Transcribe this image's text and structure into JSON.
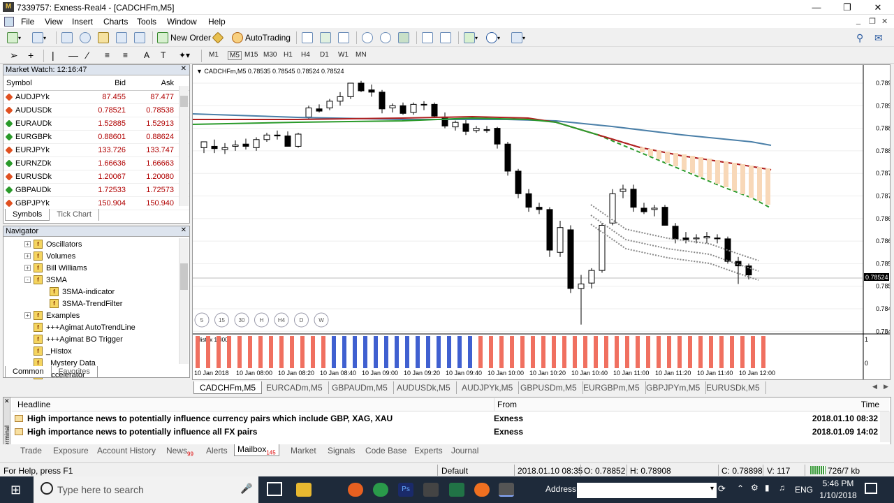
{
  "window": {
    "title": "7339757: Exness-Real4 - [CADCHFm,M5]"
  },
  "menu": [
    "File",
    "View",
    "Insert",
    "Charts",
    "Tools",
    "Window",
    "Help"
  ],
  "toolbar": {
    "new_order": "New Order",
    "auto_trading": "AutoTrading"
  },
  "timeframes": [
    "M1",
    "M5",
    "M15",
    "M30",
    "H1",
    "H4",
    "D1",
    "W1",
    "MN"
  ],
  "market_watch": {
    "title": "Market Watch: 12:16:47",
    "cols": [
      "Symbol",
      "Bid",
      "Ask"
    ],
    "rows": [
      {
        "symbol": "AUDJPYk",
        "bid": "87.455",
        "ask": "87.477",
        "dir": "down"
      },
      {
        "symbol": "AUDUSDk",
        "bid": "0.78521",
        "ask": "0.78538",
        "dir": "down"
      },
      {
        "symbol": "EURAUDk",
        "bid": "1.52885",
        "ask": "1.52913",
        "dir": "up"
      },
      {
        "symbol": "EURGBPk",
        "bid": "0.88601",
        "ask": "0.88624",
        "dir": "up"
      },
      {
        "symbol": "EURJPYk",
        "bid": "133.726",
        "ask": "133.747",
        "dir": "down"
      },
      {
        "symbol": "EURNZDk",
        "bid": "1.66636",
        "ask": "1.66663",
        "dir": "up"
      },
      {
        "symbol": "EURUSDk",
        "bid": "1.20067",
        "ask": "1.20080",
        "dir": "down"
      },
      {
        "symbol": "GBPAUDk",
        "bid": "1.72533",
        "ask": "1.72573",
        "dir": "up"
      },
      {
        "symbol": "GBPJPYk",
        "bid": "150.904",
        "ask": "150.940",
        "dir": "down"
      }
    ],
    "tabs": [
      "Symbols",
      "Tick Chart"
    ]
  },
  "navigator": {
    "title": "Navigator",
    "items": [
      "Oscillators",
      "Volumes",
      "Bill Williams",
      "3SMA",
      "3SMA-indicator",
      "3SMA-TrendFilter",
      "Examples",
      "+++Agimat AutoTrendLine",
      "+++Agimat BO Trigger",
      "_Histox",
      "_Mystery Data",
      "Accelerator"
    ],
    "tabs": [
      "Common",
      "Favorites"
    ]
  },
  "chart": {
    "header": "CADCHFm,M5  0.78535 0.78545 0.78524 0.78524",
    "price_labels": [
      "0.78955",
      "0.78905",
      "0.78855",
      "0.78805",
      "0.78755",
      "0.78705",
      "0.78655",
      "0.78605",
      "0.78555",
      "0.78505",
      "0.78455",
      "0.78405"
    ],
    "current_price": "0.78524",
    "time_labels": [
      "10 Jan 2018",
      "10 Jan 08:00",
      "10 Jan 08:20",
      "10 Jan 08:40",
      "10 Jan 09:00",
      "10 Jan 09:20",
      "10 Jan 09:40",
      "10 Jan 10:00",
      "10 Jan 10:20",
      "10 Jan 10:40",
      "10 Jan 11:00",
      "10 Jan 11:20",
      "10 Jan 11:40",
      "10 Jan 12:00"
    ],
    "tf_buttons": [
      "5",
      "15",
      "30",
      "H",
      "H4",
      "D",
      "W"
    ],
    "sub_label": "Histox 1.0000",
    "sub_scale": [
      "1",
      "0"
    ]
  },
  "chart_tabs": [
    "CADCHFm,M5",
    "EURCADm,M5",
    "GBPAUDm,M5",
    "AUDUSDk,M5",
    "AUDJPYk,M5",
    "GBPUSDm,M5",
    "EURGBPm,M5",
    "GBPJPYm,M5",
    "EURUSDk,M5"
  ],
  "terminal": {
    "cols": [
      "Headline",
      "From",
      "Time"
    ],
    "rows": [
      {
        "headline": "High importance news to potentially influence currency pairs which include GBP, XAG, XAU",
        "from": "Exness",
        "time": "2018.01.10 08:32"
      },
      {
        "headline": "High importance news to potentially influence all FX pairs",
        "from": "Exness",
        "time": "2018.01.09 14:02"
      }
    ],
    "tabs": [
      "Trade",
      "Exposure",
      "Account History",
      "News",
      "Alerts",
      "Mailbox",
      "Market",
      "Signals",
      "Code Base",
      "Experts",
      "Journal"
    ],
    "news_badge": "99",
    "mailbox_badge": "145",
    "side_label": "Terminal"
  },
  "status": {
    "help": "For Help, press F1",
    "profile": "Default",
    "datetime": "2018.01.10 08:35",
    "open": "O: 0.78852",
    "high": "H: 0.78908",
    "close": "C: 0.78898",
    "volume": "V: 117",
    "traffic": "726/7 kb"
  },
  "taskbar": {
    "search_placeholder": "Type here to search",
    "address_label": "Address",
    "lang": "ENG",
    "time": "5:46 PM",
    "date": "1/10/2018"
  },
  "colors": {
    "bull": "#ffffff",
    "bear": "#000000",
    "sma_blue": "#4a7fa8",
    "sma_red": "#b02020",
    "sma_green": "#2a9a2a",
    "histo_red": "#f07060",
    "histo_blue": "#4060d0"
  }
}
